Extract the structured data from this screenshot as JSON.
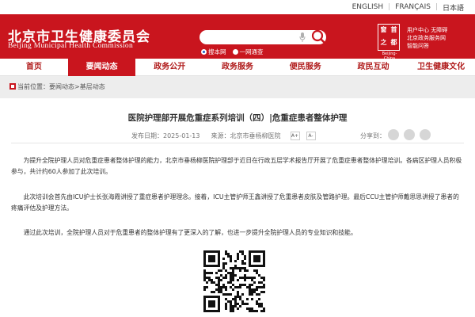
{
  "lang": {
    "english": "ENGLISH",
    "french": "FRANÇAIS",
    "japanese": "日本語"
  },
  "header": {
    "title_cn": "北京市卫生健康委员会",
    "title_en": "Beijing Municipal Health Commission",
    "search_placeholder": "",
    "radio_site": "搜本网",
    "radio_all": "一网通查",
    "seal_chars": [
      "首",
      "都",
      "之",
      "窗"
    ],
    "seal_caption": "Beijing-China",
    "links": [
      "用户中心 无障碍",
      "北京政务服务网",
      "智能问答"
    ],
    "accent": "#c9151e"
  },
  "nav": {
    "items": [
      "首页",
      "要闻动态",
      "政务公开",
      "政务服务",
      "便民服务",
      "政民互动",
      "卫生健康文化"
    ]
  },
  "breadcrumb": {
    "text": "当前位置：要闻动态>基层动态"
  },
  "article": {
    "title": "医院护理部开展危重症系列培训（四）|危重症患者整体护理",
    "date_label": "发布日期：2025-01-13",
    "source_label": "来源：北京市垂杨柳医院",
    "font_plus": "A+",
    "font_minus": "A-",
    "share_label": "分享到：",
    "paragraphs": [
      "为提升全院护理人员对危重症患者整体护理的能力，北京市垂杨柳医院护理部于近日在行政五层学术报告厅开展了危重症患者整体护理培训。各病区护理人员积极参与，共计约60人参加了此次培训。",
      "此次培训会首先由ICU护士长张海霞讲授了重症患者护理理念。接着，ICU主管护师王鑫讲授了危重患者皮肤及管路护理。最后CCU主管护师戴思思讲授了患者的疼痛评估及护理方法。",
      "通过此次培训，全院护理人员对于危重患者的整体护理有了更深入的了解，也进一步提升全院护理人员的专业知识和技能。"
    ]
  }
}
